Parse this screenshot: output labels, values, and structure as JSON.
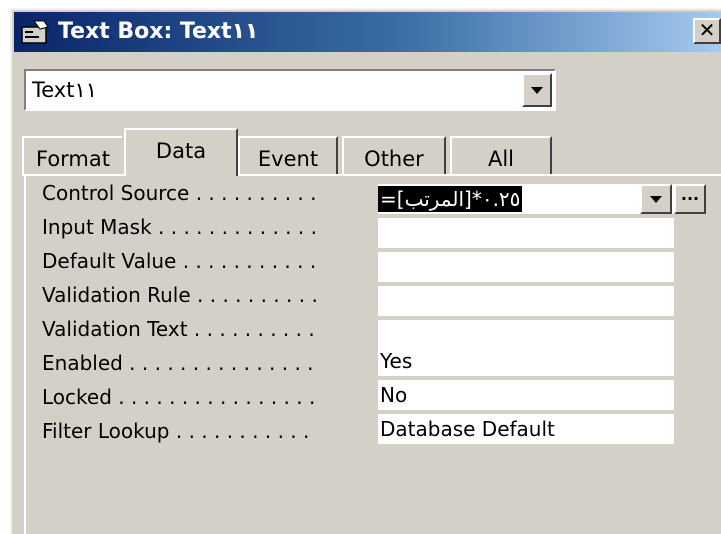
{
  "window": {
    "title": "Text Box: Text١١",
    "close_label": "✕"
  },
  "combo": {
    "selected": "Text١١"
  },
  "tabs": [
    {
      "label": "Format"
    },
    {
      "label": "Data"
    },
    {
      "label": "Event"
    },
    {
      "label": "Other"
    },
    {
      "label": "All"
    }
  ],
  "active_tab": "Data",
  "properties": [
    {
      "label": "Control Source . . . . . . . . . .",
      "value": "=[المرتب]*٠.٢٥"
    },
    {
      "label": "Input Mask . . . . . . . . . . . . .",
      "value": ""
    },
    {
      "label": "Default Value . . . . . . . . . . .",
      "value": ""
    },
    {
      "label": "Validation Rule . . . . . . . . . .",
      "value": ""
    },
    {
      "label": "Validation Text . . . . . . . . . .",
      "value": ""
    },
    {
      "label": "Enabled . . . . . . . . . . . . . . .",
      "value": "Yes"
    },
    {
      "label": "Locked . . . . . . . . . . . . . . . .",
      "value": "No"
    },
    {
      "label": "Filter Lookup . . . . . . . . . . .",
      "value": "Database Default"
    }
  ],
  "builder_button_label": "..."
}
